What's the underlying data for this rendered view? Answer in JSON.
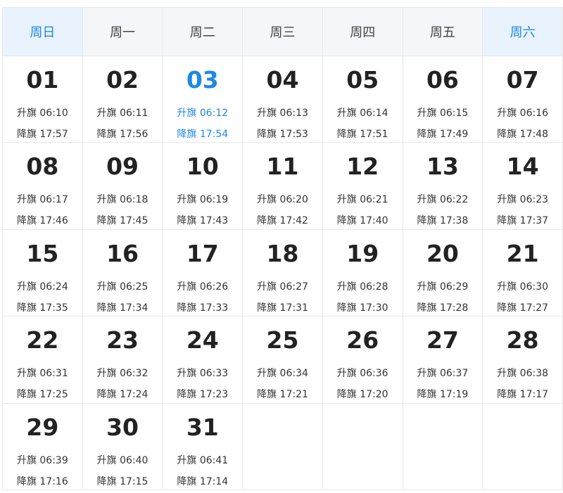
{
  "weekdays": [
    "周日",
    "周一",
    "周二",
    "周三",
    "周四",
    "周五",
    "周六"
  ],
  "days": [
    {
      "num": "01",
      "rise": "升旗 06:10",
      "set": "降旗 17:57"
    },
    {
      "num": "02",
      "rise": "升旗 06:11",
      "set": "降旗 17:56"
    },
    {
      "num": "03",
      "rise": "升旗 06:12",
      "set": "降旗 17:54",
      "today": true
    },
    {
      "num": "04",
      "rise": "升旗 06:13",
      "set": "降旗 17:53"
    },
    {
      "num": "05",
      "rise": "升旗 06:14",
      "set": "降旗 17:51"
    },
    {
      "num": "06",
      "rise": "升旗 06:15",
      "set": "降旗 17:49"
    },
    {
      "num": "07",
      "rise": "升旗 06:16",
      "set": "降旗 17:48"
    },
    {
      "num": "08",
      "rise": "升旗 06:17",
      "set": "降旗 17:46"
    },
    {
      "num": "09",
      "rise": "升旗 06:18",
      "set": "降旗 17:45"
    },
    {
      "num": "10",
      "rise": "升旗 06:19",
      "set": "降旗 17:43"
    },
    {
      "num": "11",
      "rise": "升旗 06:20",
      "set": "降旗 17:42"
    },
    {
      "num": "12",
      "rise": "升旗 06:21",
      "set": "降旗 17:40"
    },
    {
      "num": "13",
      "rise": "升旗 06:22",
      "set": "降旗 17:38"
    },
    {
      "num": "14",
      "rise": "升旗 06:23",
      "set": "降旗 17:37"
    },
    {
      "num": "15",
      "rise": "升旗 06:24",
      "set": "降旗 17:35"
    },
    {
      "num": "16",
      "rise": "升旗 06:25",
      "set": "降旗 17:34"
    },
    {
      "num": "17",
      "rise": "升旗 06:26",
      "set": "降旗 17:33"
    },
    {
      "num": "18",
      "rise": "升旗 06:27",
      "set": "降旗 17:31"
    },
    {
      "num": "19",
      "rise": "升旗 06:28",
      "set": "降旗 17:30"
    },
    {
      "num": "20",
      "rise": "升旗 06:29",
      "set": "降旗 17:28"
    },
    {
      "num": "21",
      "rise": "升旗 06:30",
      "set": "降旗 17:27"
    },
    {
      "num": "22",
      "rise": "升旗 06:31",
      "set": "降旗 17:25"
    },
    {
      "num": "23",
      "rise": "升旗 06:32",
      "set": "降旗 17:24"
    },
    {
      "num": "24",
      "rise": "升旗 06:33",
      "set": "降旗 17:23"
    },
    {
      "num": "25",
      "rise": "升旗 06:34",
      "set": "降旗 17:21"
    },
    {
      "num": "26",
      "rise": "升旗 06:36",
      "set": "降旗 17:20"
    },
    {
      "num": "27",
      "rise": "升旗 06:37",
      "set": "降旗 17:19"
    },
    {
      "num": "28",
      "rise": "升旗 06:38",
      "set": "降旗 17:17"
    },
    {
      "num": "29",
      "rise": "升旗 06:39",
      "set": "降旗 17:16"
    },
    {
      "num": "30",
      "rise": "升旗 06:40",
      "set": "降旗 17:15"
    },
    {
      "num": "31",
      "rise": "升旗 06:41",
      "set": "降旗 17:14"
    }
  ],
  "colors": {
    "accent": "#1e88e5",
    "weekend_header_bg": "#e8f3fd",
    "weekday_header_bg": "#f4f6f9",
    "grid_line": "#e8e8e8"
  }
}
